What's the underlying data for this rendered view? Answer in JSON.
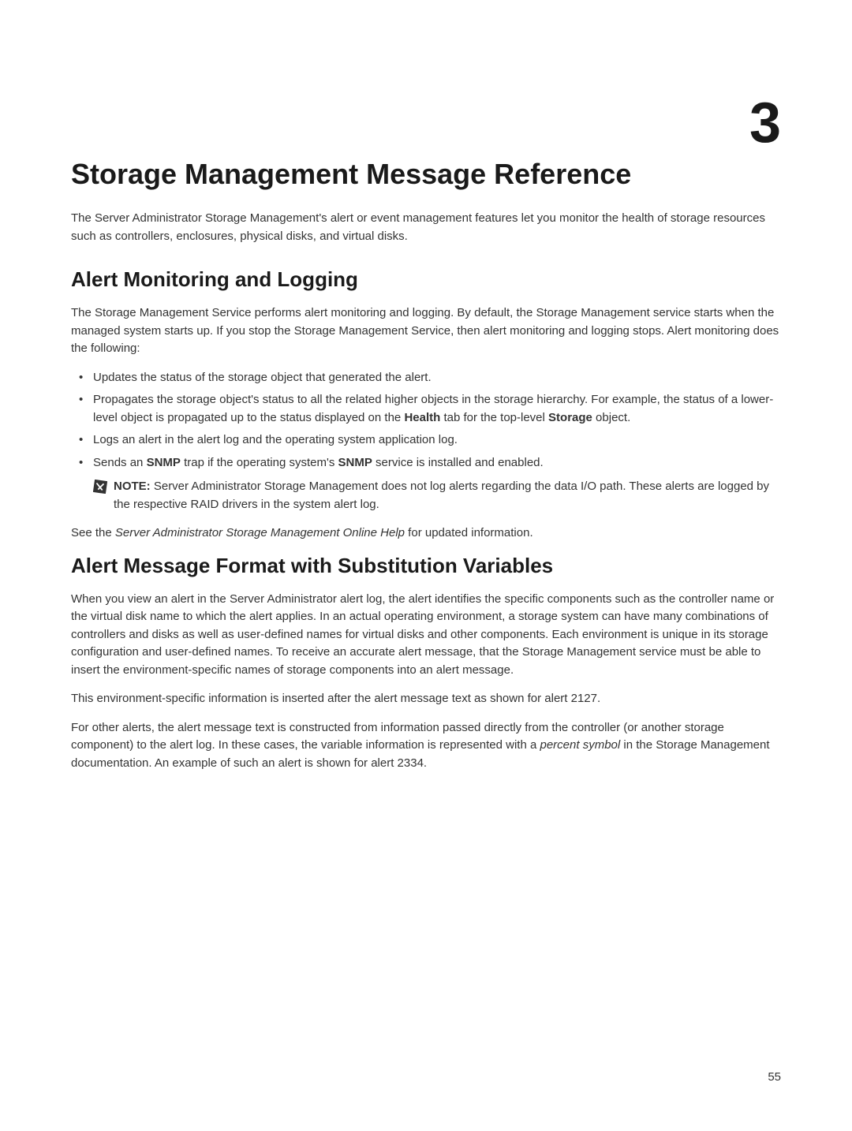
{
  "chapter_number": "3",
  "chapter_title": "Storage Management Message Reference",
  "intro": "The Server Administrator Storage Management's alert or event management features let you monitor the health of storage resources such as controllers, enclosures, physical disks, and virtual disks.",
  "section1": {
    "title": "Alert Monitoring and Logging",
    "body": "The Storage Management Service performs alert monitoring and logging. By default, the Storage Management service starts when the managed system starts up. If you stop the Storage Management Service, then alert monitoring and logging stops. Alert monitoring does the following:",
    "bullets": {
      "b1": "Updates the status of the storage object that generated the alert.",
      "b2_pre": "Propagates the storage object's status to all the related higher objects in the storage hierarchy. For example, the status of a lower-level object is propagated up to the status displayed on the ",
      "b2_bold1": "Health",
      "b2_mid": " tab for the top-level ",
      "b2_bold2": "Storage",
      "b2_post": " object.",
      "b3": "Logs an alert in the alert log and the operating system application log.",
      "b4_pre": "Sends an ",
      "b4_bold1": "SNMP",
      "b4_mid": " trap if the operating system's ",
      "b4_bold2": "SNMP",
      "b4_post": " service is installed and enabled."
    },
    "note_label": "NOTE: ",
    "note_text": "Server Administrator Storage Management does not log alerts regarding the data I/O path. These alerts are logged by the respective RAID drivers in the system alert log.",
    "see_pre": "See the ",
    "see_italic": "Server Administrator Storage Management Online Help",
    "see_post": " for updated information."
  },
  "section2": {
    "title": "Alert Message Format with Substitution Variables",
    "p1": "When you view an alert in the Server Administrator alert log, the alert identifies the specific components such as the controller name or the virtual disk name to which the alert applies. In an actual operating environment, a storage system can have many combinations of controllers and disks as well as user-defined names for virtual disks and other components. Each environment is unique in its storage configuration and user-defined names. To receive an accurate alert message, that the Storage Management service must be able to insert the environment-specific names of storage components into an alert message.",
    "p2": "This environment-specific information is inserted after the alert message text as shown for alert 2127.",
    "p3_pre": "For other alerts, the alert message text is constructed from information passed directly from the controller (or another storage component) to the alert log. In these cases, the variable information is represented with a ",
    "p3_italic": "percent symbol",
    "p3_post": " in the Storage Management documentation. An example of such an alert is shown for alert 2334."
  },
  "page_number": "55"
}
